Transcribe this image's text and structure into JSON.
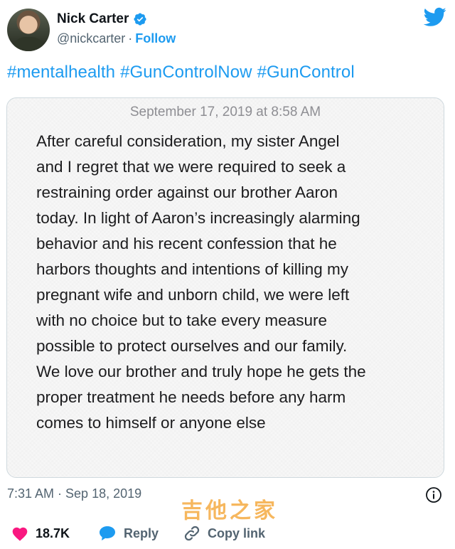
{
  "tweet": {
    "display_name": "Nick Carter",
    "handle": "@nickcarter",
    "separator": "·",
    "follow_label": "Follow",
    "hashtags": [
      "#mentalhealth",
      "#GunControlNow",
      "#GunControl"
    ],
    "note": {
      "date": "September 17, 2019 at 8:58 AM",
      "body": "After careful consideration, my sister Angel\nand I regret that we were required to seek a\nrestraining order against our brother Aaron\ntoday.  In light of Aaron’s increasingly alarming\nbehavior and his recent confession that he\nharbors thoughts and intentions of killing my\npregnant wife and unborn child, we were left\nwith no choice but to take every measure\npossible to protect ourselves and our family.\nWe love our brother and truly hope he gets the\nproper treatment he needs before any harm\ncomes to himself or anyone else"
    },
    "timestamp": "7:31 AM · Sep 18, 2019",
    "actions": {
      "like_count": "18.7K",
      "reply_label": "Reply",
      "copy_link_label": "Copy link"
    },
    "watermark": "吉他之家",
    "colors": {
      "accent": "#1d9bf0",
      "like": "#f91880",
      "text": "#0f1419",
      "muted": "#536471"
    },
    "icons": [
      "avatar",
      "verified-badge-icon",
      "twitter-bird-icon",
      "info-icon",
      "heart-icon",
      "reply-bubble-icon",
      "link-icon"
    ]
  }
}
